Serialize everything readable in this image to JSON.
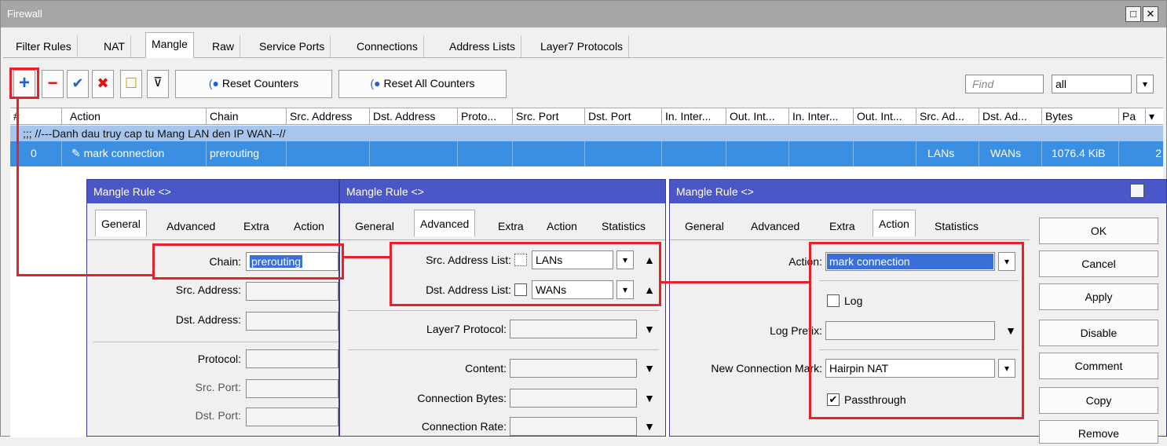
{
  "window": {
    "title": "Firewall",
    "btn_restore": "□",
    "btn_close": "✕"
  },
  "tabs": [
    "Filter Rules",
    "NAT",
    "Mangle",
    "Raw",
    "Service Ports",
    "Connections",
    "Address Lists",
    "Layer7 Protocols"
  ],
  "toolbar": {
    "add": "+",
    "remove": "−",
    "enable": "✔",
    "disable": "✖",
    "comment": "☐",
    "filter": "⊽",
    "reset_counters": "Reset Counters",
    "reset_all_counters": "Reset All Counters",
    "find_placeholder": "Find",
    "filter_value": "all",
    "filter_arrow": "▾"
  },
  "table": {
    "headers": [
      "#",
      "Action",
      "Chain",
      "Src. Address",
      "Dst. Address",
      "Proto...",
      "Src. Port",
      "Dst. Port",
      "In. Inter...",
      "Out. Int...",
      "In. Inter...",
      "Out. Int...",
      "Src. Ad...",
      "Dst. Ad...",
      "Bytes",
      "Pa"
    ],
    "header_menu": "▾",
    "comment": ";;; //---Danh dau truy cap tu Mang LAN den IP WAN--//",
    "row": {
      "num": "0",
      "action": "mark connection",
      "chain": "prerouting",
      "src_list": "LANs",
      "dst_list": "WANs",
      "bytes": "1076.4 KiB",
      "packets": "2"
    }
  },
  "dialog1": {
    "title": "Mangle Rule <>",
    "tabs": [
      "General",
      "Advanced",
      "Extra",
      "Action"
    ],
    "chain_label": "Chain:",
    "chain_value": "prerouting",
    "src_address_label": "Src. Address:",
    "dst_address_label": "Dst. Address:",
    "protocol_label": "Protocol:",
    "src_port_label": "Src. Port:",
    "dst_port_label": "Dst. Port:"
  },
  "dialog2": {
    "title": "Mangle Rule <>",
    "tabs": [
      "General",
      "Advanced",
      "Extra",
      "Action",
      "Statistics"
    ],
    "src_list_label": "Src. Address List:",
    "src_list_value": "LANs",
    "dst_list_label": "Dst. Address List:",
    "dst_list_value": "WANs",
    "layer7_label": "Layer7 Protocol:",
    "content_label": "Content:",
    "conn_bytes_label": "Connection Bytes:",
    "conn_rate_label": "Connection Rate:",
    "arrow_up": "▲",
    "arrow_down": "▼",
    "dd": "▾"
  },
  "dialog3": {
    "title": "Mangle Rule <>",
    "tabs": [
      "General",
      "Advanced",
      "Extra",
      "Action",
      "Statistics"
    ],
    "action_label": "Action:",
    "action_value": "mark connection",
    "log_label": "Log",
    "log_prefix_label": "Log Prefix:",
    "new_conn_mark_label": "New Connection Mark:",
    "new_conn_mark_value": "Hairpin NAT",
    "passthrough_label": "Passthrough",
    "passthrough_check": "✔"
  },
  "side_buttons": [
    "OK",
    "Cancel",
    "Apply",
    "Disable",
    "Comment",
    "Copy",
    "Remove"
  ],
  "colors": {
    "annotation": "#e8202a",
    "dialog_title": "#4a57c8",
    "selected_row": "#3a8fe3",
    "comment_row": "#a7c6ee"
  }
}
